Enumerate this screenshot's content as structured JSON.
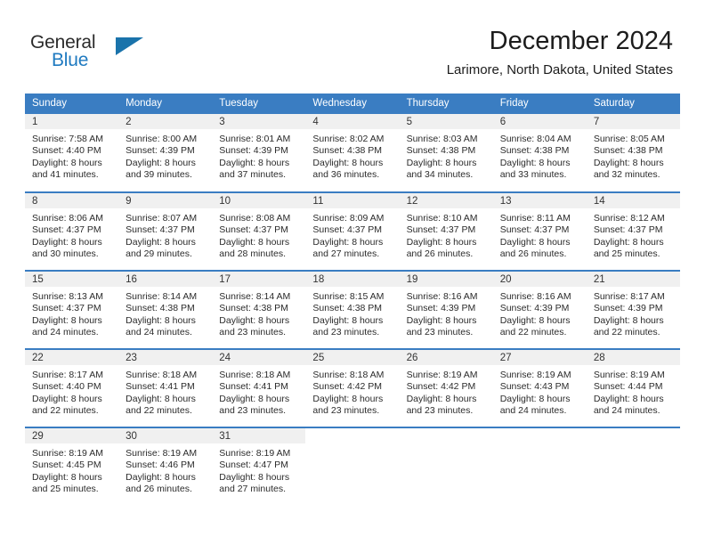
{
  "brand": {
    "word_one": "General",
    "word_two": "Blue",
    "triangle_icon": "blue-triangle-logo-icon"
  },
  "header": {
    "month_title": "December 2024",
    "location": "Larimore, North Dakota, United States"
  },
  "calendar": {
    "weekday_headers": [
      "Sunday",
      "Monday",
      "Tuesday",
      "Wednesday",
      "Thursday",
      "Friday",
      "Saturday"
    ],
    "accent_color": "#3a7dc2",
    "daynum_band_color": "#f0f0f0",
    "weeks": [
      [
        {
          "day": "1",
          "sunrise": "Sunrise: 7:58 AM",
          "sunset": "Sunset: 4:40 PM",
          "daylight_line1": "Daylight: 8 hours",
          "daylight_line2": "and 41 minutes."
        },
        {
          "day": "2",
          "sunrise": "Sunrise: 8:00 AM",
          "sunset": "Sunset: 4:39 PM",
          "daylight_line1": "Daylight: 8 hours",
          "daylight_line2": "and 39 minutes."
        },
        {
          "day": "3",
          "sunrise": "Sunrise: 8:01 AM",
          "sunset": "Sunset: 4:39 PM",
          "daylight_line1": "Daylight: 8 hours",
          "daylight_line2": "and 37 minutes."
        },
        {
          "day": "4",
          "sunrise": "Sunrise: 8:02 AM",
          "sunset": "Sunset: 4:38 PM",
          "daylight_line1": "Daylight: 8 hours",
          "daylight_line2": "and 36 minutes."
        },
        {
          "day": "5",
          "sunrise": "Sunrise: 8:03 AM",
          "sunset": "Sunset: 4:38 PM",
          "daylight_line1": "Daylight: 8 hours",
          "daylight_line2": "and 34 minutes."
        },
        {
          "day": "6",
          "sunrise": "Sunrise: 8:04 AM",
          "sunset": "Sunset: 4:38 PM",
          "daylight_line1": "Daylight: 8 hours",
          "daylight_line2": "and 33 minutes."
        },
        {
          "day": "7",
          "sunrise": "Sunrise: 8:05 AM",
          "sunset": "Sunset: 4:38 PM",
          "daylight_line1": "Daylight: 8 hours",
          "daylight_line2": "and 32 minutes."
        }
      ],
      [
        {
          "day": "8",
          "sunrise": "Sunrise: 8:06 AM",
          "sunset": "Sunset: 4:37 PM",
          "daylight_line1": "Daylight: 8 hours",
          "daylight_line2": "and 30 minutes."
        },
        {
          "day": "9",
          "sunrise": "Sunrise: 8:07 AM",
          "sunset": "Sunset: 4:37 PM",
          "daylight_line1": "Daylight: 8 hours",
          "daylight_line2": "and 29 minutes."
        },
        {
          "day": "10",
          "sunrise": "Sunrise: 8:08 AM",
          "sunset": "Sunset: 4:37 PM",
          "daylight_line1": "Daylight: 8 hours",
          "daylight_line2": "and 28 minutes."
        },
        {
          "day": "11",
          "sunrise": "Sunrise: 8:09 AM",
          "sunset": "Sunset: 4:37 PM",
          "daylight_line1": "Daylight: 8 hours",
          "daylight_line2": "and 27 minutes."
        },
        {
          "day": "12",
          "sunrise": "Sunrise: 8:10 AM",
          "sunset": "Sunset: 4:37 PM",
          "daylight_line1": "Daylight: 8 hours",
          "daylight_line2": "and 26 minutes."
        },
        {
          "day": "13",
          "sunrise": "Sunrise: 8:11 AM",
          "sunset": "Sunset: 4:37 PM",
          "daylight_line1": "Daylight: 8 hours",
          "daylight_line2": "and 26 minutes."
        },
        {
          "day": "14",
          "sunrise": "Sunrise: 8:12 AM",
          "sunset": "Sunset: 4:37 PM",
          "daylight_line1": "Daylight: 8 hours",
          "daylight_line2": "and 25 minutes."
        }
      ],
      [
        {
          "day": "15",
          "sunrise": "Sunrise: 8:13 AM",
          "sunset": "Sunset: 4:37 PM",
          "daylight_line1": "Daylight: 8 hours",
          "daylight_line2": "and 24 minutes."
        },
        {
          "day": "16",
          "sunrise": "Sunrise: 8:14 AM",
          "sunset": "Sunset: 4:38 PM",
          "daylight_line1": "Daylight: 8 hours",
          "daylight_line2": "and 24 minutes."
        },
        {
          "day": "17",
          "sunrise": "Sunrise: 8:14 AM",
          "sunset": "Sunset: 4:38 PM",
          "daylight_line1": "Daylight: 8 hours",
          "daylight_line2": "and 23 minutes."
        },
        {
          "day": "18",
          "sunrise": "Sunrise: 8:15 AM",
          "sunset": "Sunset: 4:38 PM",
          "daylight_line1": "Daylight: 8 hours",
          "daylight_line2": "and 23 minutes."
        },
        {
          "day": "19",
          "sunrise": "Sunrise: 8:16 AM",
          "sunset": "Sunset: 4:39 PM",
          "daylight_line1": "Daylight: 8 hours",
          "daylight_line2": "and 23 minutes."
        },
        {
          "day": "20",
          "sunrise": "Sunrise: 8:16 AM",
          "sunset": "Sunset: 4:39 PM",
          "daylight_line1": "Daylight: 8 hours",
          "daylight_line2": "and 22 minutes."
        },
        {
          "day": "21",
          "sunrise": "Sunrise: 8:17 AM",
          "sunset": "Sunset: 4:39 PM",
          "daylight_line1": "Daylight: 8 hours",
          "daylight_line2": "and 22 minutes."
        }
      ],
      [
        {
          "day": "22",
          "sunrise": "Sunrise: 8:17 AM",
          "sunset": "Sunset: 4:40 PM",
          "daylight_line1": "Daylight: 8 hours",
          "daylight_line2": "and 22 minutes."
        },
        {
          "day": "23",
          "sunrise": "Sunrise: 8:18 AM",
          "sunset": "Sunset: 4:41 PM",
          "daylight_line1": "Daylight: 8 hours",
          "daylight_line2": "and 22 minutes."
        },
        {
          "day": "24",
          "sunrise": "Sunrise: 8:18 AM",
          "sunset": "Sunset: 4:41 PM",
          "daylight_line1": "Daylight: 8 hours",
          "daylight_line2": "and 23 minutes."
        },
        {
          "day": "25",
          "sunrise": "Sunrise: 8:18 AM",
          "sunset": "Sunset: 4:42 PM",
          "daylight_line1": "Daylight: 8 hours",
          "daylight_line2": "and 23 minutes."
        },
        {
          "day": "26",
          "sunrise": "Sunrise: 8:19 AM",
          "sunset": "Sunset: 4:42 PM",
          "daylight_line1": "Daylight: 8 hours",
          "daylight_line2": "and 23 minutes."
        },
        {
          "day": "27",
          "sunrise": "Sunrise: 8:19 AM",
          "sunset": "Sunset: 4:43 PM",
          "daylight_line1": "Daylight: 8 hours",
          "daylight_line2": "and 24 minutes."
        },
        {
          "day": "28",
          "sunrise": "Sunrise: 8:19 AM",
          "sunset": "Sunset: 4:44 PM",
          "daylight_line1": "Daylight: 8 hours",
          "daylight_line2": "and 24 minutes."
        }
      ],
      [
        {
          "day": "29",
          "sunrise": "Sunrise: 8:19 AM",
          "sunset": "Sunset: 4:45 PM",
          "daylight_line1": "Daylight: 8 hours",
          "daylight_line2": "and 25 minutes."
        },
        {
          "day": "30",
          "sunrise": "Sunrise: 8:19 AM",
          "sunset": "Sunset: 4:46 PM",
          "daylight_line1": "Daylight: 8 hours",
          "daylight_line2": "and 26 minutes."
        },
        {
          "day": "31",
          "sunrise": "Sunrise: 8:19 AM",
          "sunset": "Sunset: 4:47 PM",
          "daylight_line1": "Daylight: 8 hours",
          "daylight_line2": "and 27 minutes."
        },
        {
          "day": "",
          "sunrise": "",
          "sunset": "",
          "daylight_line1": "",
          "daylight_line2": ""
        },
        {
          "day": "",
          "sunrise": "",
          "sunset": "",
          "daylight_line1": "",
          "daylight_line2": ""
        },
        {
          "day": "",
          "sunrise": "",
          "sunset": "",
          "daylight_line1": "",
          "daylight_line2": ""
        },
        {
          "day": "",
          "sunrise": "",
          "sunset": "",
          "daylight_line1": "",
          "daylight_line2": ""
        }
      ]
    ]
  }
}
